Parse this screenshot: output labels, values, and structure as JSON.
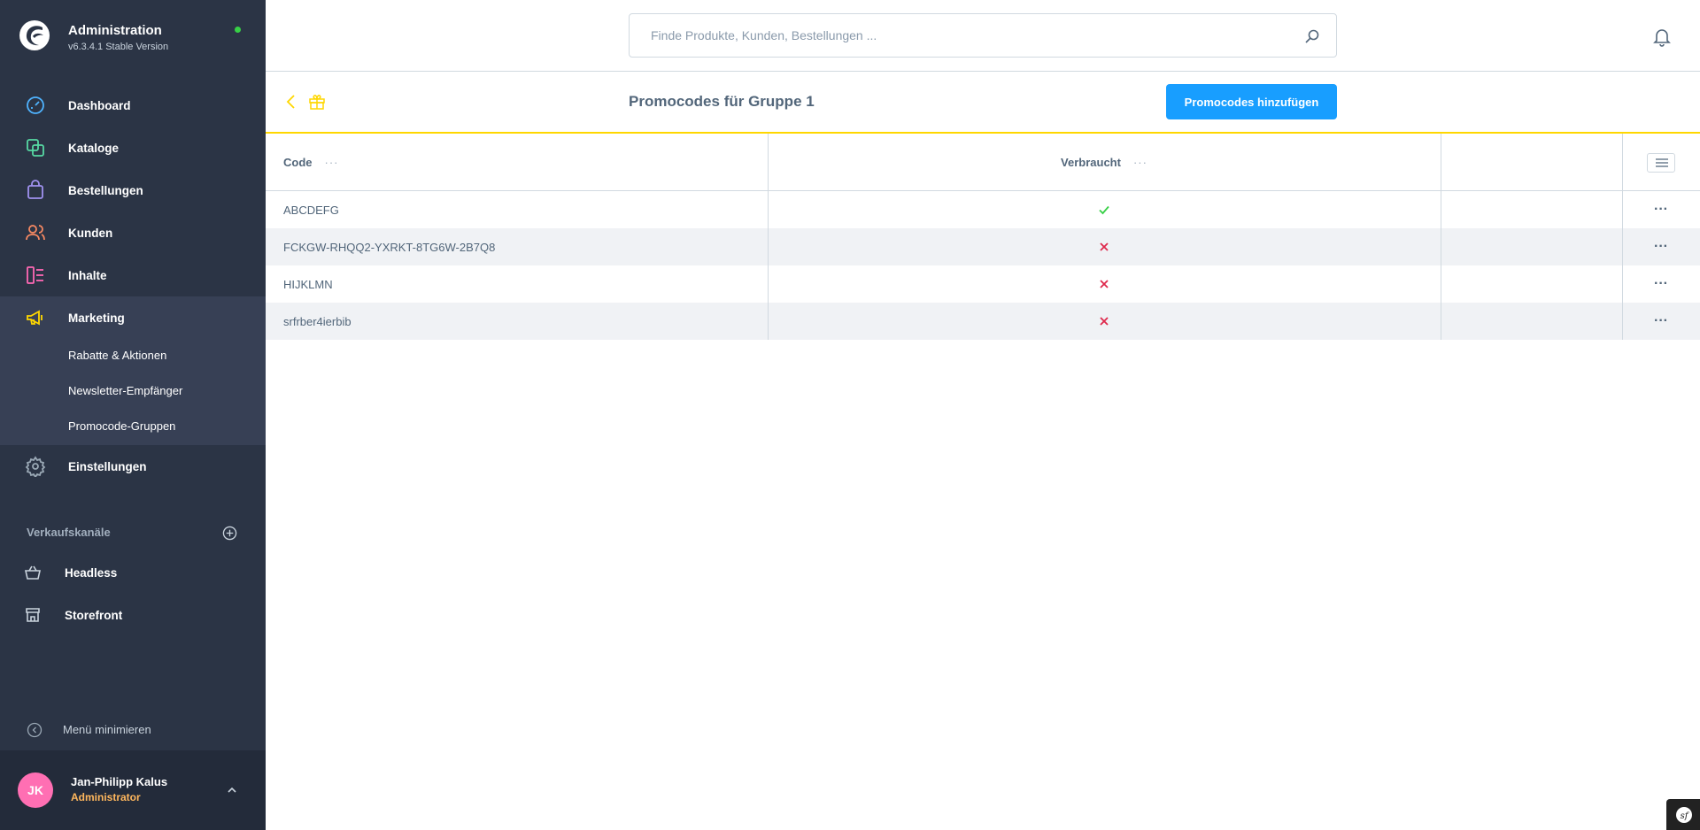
{
  "app": {
    "title": "Administration",
    "version": "v6.3.4.1 Stable Version"
  },
  "nav": {
    "items": [
      {
        "label": "Dashboard",
        "icon": "dashboard-icon",
        "color": "#4fb3ff"
      },
      {
        "label": "Kataloge",
        "icon": "catalog-icon",
        "color": "#57d9a3"
      },
      {
        "label": "Bestellungen",
        "icon": "orders-icon",
        "color": "#a092f0"
      },
      {
        "label": "Kunden",
        "icon": "customers-icon",
        "color": "#f88962"
      },
      {
        "label": "Inhalte",
        "icon": "content-icon",
        "color": "#ff68b4"
      },
      {
        "label": "Marketing",
        "icon": "marketing-icon",
        "color": "#ffd700"
      },
      {
        "label": "Einstellungen",
        "icon": "settings-icon",
        "color": "#9aa8b5"
      }
    ],
    "marketing_sub": [
      "Rabatte & Aktionen",
      "Newsletter-Empfänger",
      "Promocode-Gruppen"
    ],
    "sales_channels_label": "Verkaufskanäle",
    "sales_channels": [
      {
        "label": "Headless",
        "icon": "basket-icon"
      },
      {
        "label": "Storefront",
        "icon": "storefront-icon"
      }
    ],
    "minimize_label": "Menü minimieren"
  },
  "user": {
    "initials": "JK",
    "name": "Jan-Philipp Kalus",
    "role": "Administrator"
  },
  "search": {
    "placeholder": "Finde Produkte, Kunden, Bestellungen ..."
  },
  "smartbar": {
    "title": "Promocodes für Gruppe 1",
    "primary_button": "Promocodes hinzufügen"
  },
  "grid": {
    "columns": [
      "Code",
      "Verbraucht"
    ],
    "rows": [
      {
        "code": "ABCDEFG",
        "used": true
      },
      {
        "code": "FCKGW-RHQQ2-YXRKT-8TG6W-2B7Q8",
        "used": false
      },
      {
        "code": "HIJKLMN",
        "used": false
      },
      {
        "code": "srfrber4ierbib",
        "used": false
      }
    ],
    "header_dots": "···",
    "row_action": "···"
  },
  "colors": {
    "sidebar": "#2b3445",
    "accent": "#189eff",
    "marketing": "#ffd700",
    "success": "#37d046",
    "danger": "#de294c"
  }
}
